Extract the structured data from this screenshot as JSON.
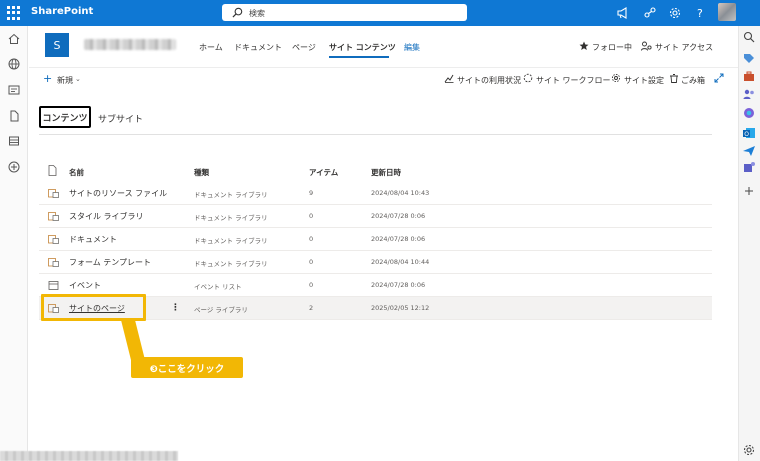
{
  "suite": {
    "brand": "SharePoint",
    "search_placeholder": "検索"
  },
  "nav": {
    "home": "ホーム",
    "documents": "ドキュメント",
    "pages": "ページ",
    "site_contents": "サイト コンテンツ",
    "edit": "編集",
    "follow": "フォロー中",
    "site_access": "サイト アクセス"
  },
  "commandbar": {
    "new": "新規",
    "usage": "サイトの利用状況",
    "workflows": "サイト ワークフロー",
    "settings": "サイト設定",
    "recycle": "ごみ箱"
  },
  "tabs": {
    "contents": "コンテンツ",
    "subsites": "サブサイト"
  },
  "table": {
    "headers": {
      "name": "名前",
      "type": "種類",
      "items": "アイテム",
      "modified": "更新日時"
    },
    "rows": [
      {
        "name": "サイトのリソース ファイル",
        "type": "ドキュメント ライブラリ",
        "items": "9",
        "modified": "2024/08/04 10:43"
      },
      {
        "name": "スタイル ライブラリ",
        "type": "ドキュメント ライブラリ",
        "items": "0",
        "modified": "2024/07/28 0:06"
      },
      {
        "name": "ドキュメント",
        "type": "ドキュメント ライブラリ",
        "items": "0",
        "modified": "2024/07/28 0:06"
      },
      {
        "name": "フォーム テンプレート",
        "type": "ドキュメント ライブラリ",
        "items": "0",
        "modified": "2024/08/04 10:44"
      },
      {
        "name": "イベント",
        "type": "イベント リスト",
        "items": "0",
        "modified": "2024/07/28 0:06"
      },
      {
        "name": "サイトのページ",
        "type": "ページ ライブラリ",
        "items": "2",
        "modified": "2025/02/05 12:12"
      }
    ],
    "more_glyph": "⋮"
  },
  "site": {
    "logo_letter": "S"
  },
  "callout": {
    "text": "❸ここをクリック"
  },
  "colors": {
    "suitebar": "#0f78d4",
    "accent": "#0f6cbd",
    "highlight": "#f2b705"
  },
  "icons": {
    "waffle": "app-launcher-icon",
    "search": "search-icon",
    "megaphone": "megaphone-icon",
    "share": "share-icon",
    "gear": "gear-icon",
    "help": "help-icon"
  }
}
